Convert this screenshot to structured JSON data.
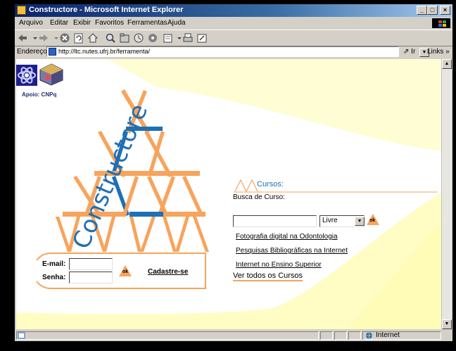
{
  "window": {
    "title": "Constructore - Microsoft Internet Explorer",
    "buttons": {
      "minimize": "_",
      "maximize": "□",
      "close": "×"
    }
  },
  "menu": [
    "Arquivo",
    "Editar",
    "Exibir",
    "Favoritos",
    "Ferramentas",
    "Ajuda"
  ],
  "toolbar": {
    "icons": [
      "back-icon",
      "forward-icon",
      "stop-icon",
      "refresh-icon",
      "home-icon",
      "search-icon",
      "favorites-icon",
      "history-icon",
      "mail-icon",
      "print-icon",
      "edit-icon"
    ]
  },
  "address": {
    "label": "Endereço",
    "url": "http://ltc.nutes.ufrj.br/ferramenta/",
    "go": "Ir",
    "links": "Links"
  },
  "page": {
    "support": "Apoio: CNPq",
    "logo_text": "Constructore",
    "login": {
      "email_label": "E-mail:",
      "password_label": "Senha:",
      "ok": "ok",
      "register": "Cadastre-se"
    },
    "cursos": {
      "heading": "Cursos:",
      "search_label": "Busca de Curso:",
      "select_value": "Livre",
      "ok": "ok",
      "links": [
        "Fotografia digital na Odontologia",
        "Pesquisas Bibliográficas na Internet",
        "Internet no Ensino Superior"
      ],
      "all": "Ver todos os Cursos"
    }
  },
  "status": {
    "zone": "Internet"
  },
  "colors": {
    "orange": "#f7a45c",
    "blue": "#1f6fb4",
    "cream": "#fffdc4",
    "titlebar": "#0a246a"
  }
}
